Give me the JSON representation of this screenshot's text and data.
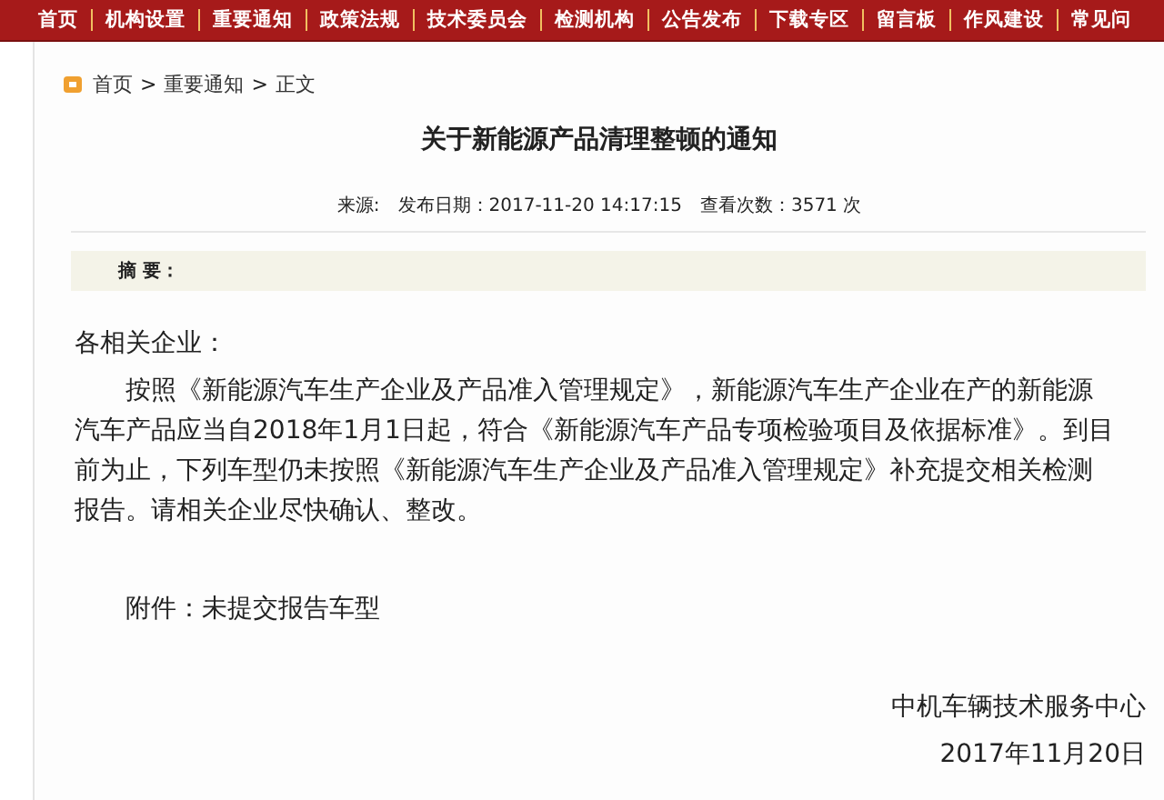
{
  "nav": [
    "首页",
    "机构设置",
    "重要通知",
    "政策法规",
    "技术委员会",
    "检测机构",
    "公告发布",
    "下载专区",
    "留言板",
    "作风建设",
    "常见问"
  ],
  "breadcrumb": [
    "首页",
    "重要通知",
    "正文"
  ],
  "breadcrumb_separator": ">",
  "title": "关于新能源产品清理整顿的通知",
  "meta": [
    "来源:",
    "发布日期：2017-11-20 14:17:15",
    "查看次数：3571 次"
  ],
  "summary_label": "摘 要：",
  "salutation": "各相关企业：",
  "body": "按照《新能源汽车生产企业及产品准入管理规定》，新能源汽车生产企业在产的新能源汽车产品应当自2018年1月1日起，符合《新能源汽车产品专项检验项目及依据标准》。到目前为止，下列车型仍未按照《新能源汽车生产企业及产品准入管理规定》补充提交相关检测报告。请相关企业尽快确认、整改。",
  "attachment": "附件：未提交报告车型",
  "signature": "中机车辆技术服务中心",
  "date": "2017年11月20日"
}
